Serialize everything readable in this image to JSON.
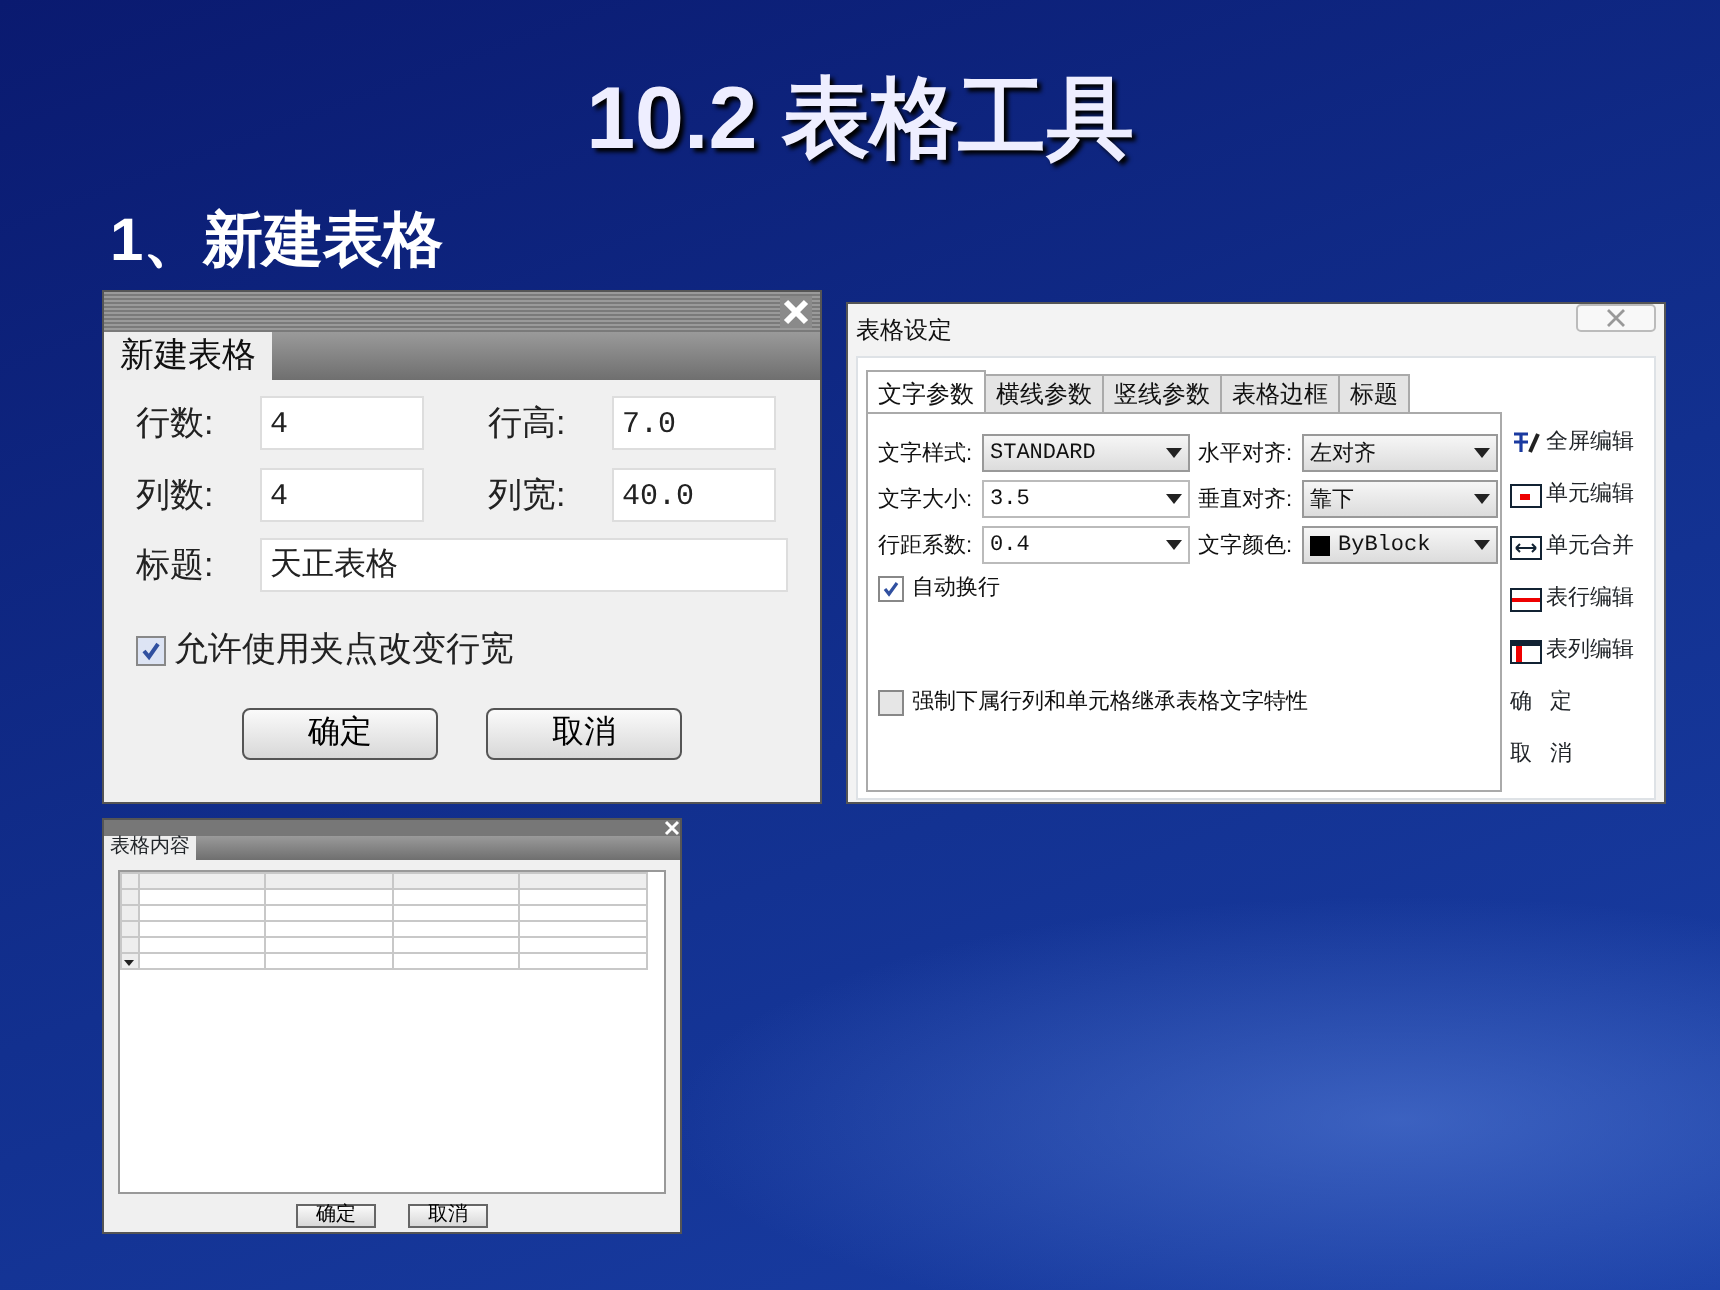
{
  "slide": {
    "title": "10.2 表格工具",
    "subtitle": "1、新建表格"
  },
  "new_table_dialog": {
    "tab": "新建表格",
    "fields": [
      {
        "label": "行数:",
        "value": "4"
      },
      {
        "label": "行高:",
        "value": "7.0"
      },
      {
        "label": "列数:",
        "value": "4"
      },
      {
        "label": "列宽:",
        "value": "40.0"
      }
    ],
    "title_field": {
      "label": "标题:",
      "value": "天正表格"
    },
    "checkbox": {
      "label": "允许使用夹点改变行宽",
      "checked": true
    },
    "buttons": [
      "确定",
      "取消"
    ]
  },
  "table_settings_dialog": {
    "title": "表格设定",
    "tabs": [
      {
        "label": "文字参数",
        "selected": true
      },
      {
        "label": "横线参数",
        "selected": false
      },
      {
        "label": "竖线参数",
        "selected": false
      },
      {
        "label": "表格边框",
        "selected": false
      },
      {
        "label": "标题",
        "selected": false
      }
    ],
    "fields": [
      {
        "label": "文字样式:",
        "value": "STANDARD",
        "kind": "combo"
      },
      {
        "label": "水平对齐:",
        "value": "左对齐",
        "kind": "combo"
      },
      {
        "label": "文字大小:",
        "value": "3.5",
        "kind": "edit"
      },
      {
        "label": "垂直对齐:",
        "value": "靠下",
        "kind": "combo"
      },
      {
        "label": "行距系数:",
        "value": "0.4",
        "kind": "edit"
      },
      {
        "label": "文字颜色:",
        "value": "ByBlock",
        "kind": "color",
        "color": "#000000"
      }
    ],
    "checkboxes": [
      {
        "label": "自动换行",
        "checked": true
      },
      {
        "label": "强制下属行列和单元格继承表格文字特性",
        "checked": false
      }
    ],
    "side_buttons": [
      {
        "label": "全屏编辑",
        "kind": "text"
      },
      {
        "label": "单元编辑",
        "kind": "cell"
      },
      {
        "label": "单元合并",
        "kind": "merge"
      },
      {
        "label": "表行编辑",
        "kind": "row"
      },
      {
        "label": "表列编辑",
        "kind": "column"
      },
      {
        "label": "确 定",
        "kind": "plain"
      },
      {
        "label": "取 消",
        "kind": "plain"
      }
    ]
  },
  "table_content_dialog": {
    "tab": "表格内容",
    "buttons": [
      "确定",
      "取消"
    ]
  }
}
